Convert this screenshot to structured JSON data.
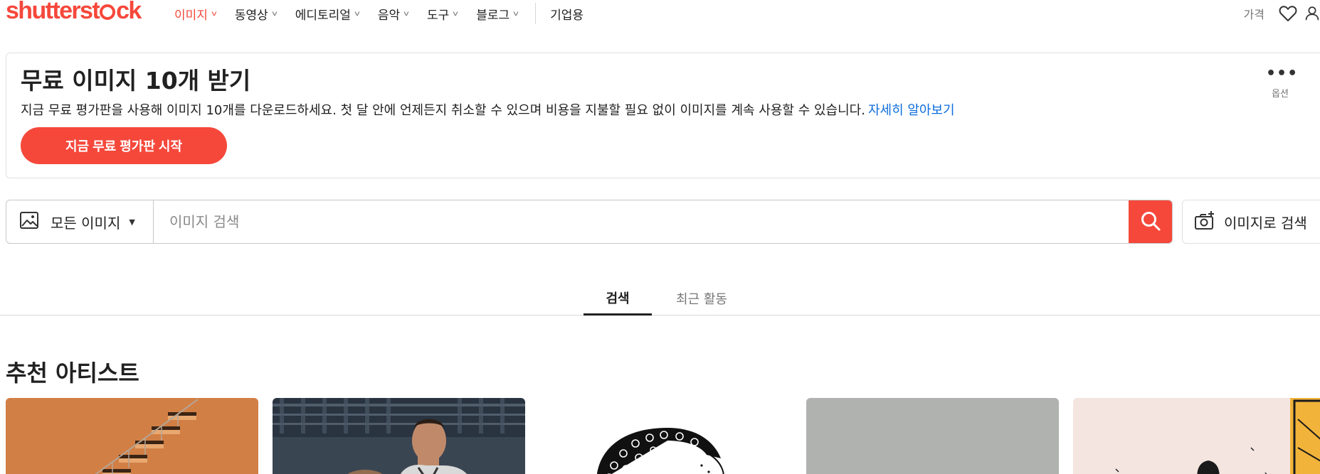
{
  "header": {
    "logo_text_a": "shutterst",
    "logo_text_b": "ck",
    "nav": [
      {
        "label": "이미지",
        "active": true
      },
      {
        "label": "동영상",
        "active": false
      },
      {
        "label": "에디토리얼",
        "active": false
      },
      {
        "label": "음악",
        "active": false
      },
      {
        "label": "도구",
        "active": false
      },
      {
        "label": "블로그",
        "active": false
      }
    ],
    "enterprise": "기업용",
    "pricing": "가격"
  },
  "promo": {
    "title": "무료 이미지 10개 받기",
    "description": "지금 무료 평가판을 사용해 이미지 10개를 다운로드하세요. 첫 달 안에 언제든지 취소할 수 있으며 비용을 지불할 필요 없이 이미지를 계속 사용할 수 있습니다.",
    "link": "자세히 알아보기",
    "button": "지금 무료 평가판 시작",
    "options_label": "옵션"
  },
  "search": {
    "type_label": "모든 이미지",
    "placeholder": "이미지 검색",
    "image_search_label": "이미지로 검색"
  },
  "tabs": [
    {
      "label": "검색",
      "active": true
    },
    {
      "label": "최근 활동",
      "active": false
    }
  ],
  "featured": {
    "title": "추천 아티스트"
  },
  "colors": {
    "brand": "#f5483b",
    "link": "#0b6cdc"
  },
  "icons": [
    "heart-icon",
    "user-icon",
    "image-icon",
    "search-icon",
    "camera-plus-icon",
    "more-dots-icon"
  ]
}
